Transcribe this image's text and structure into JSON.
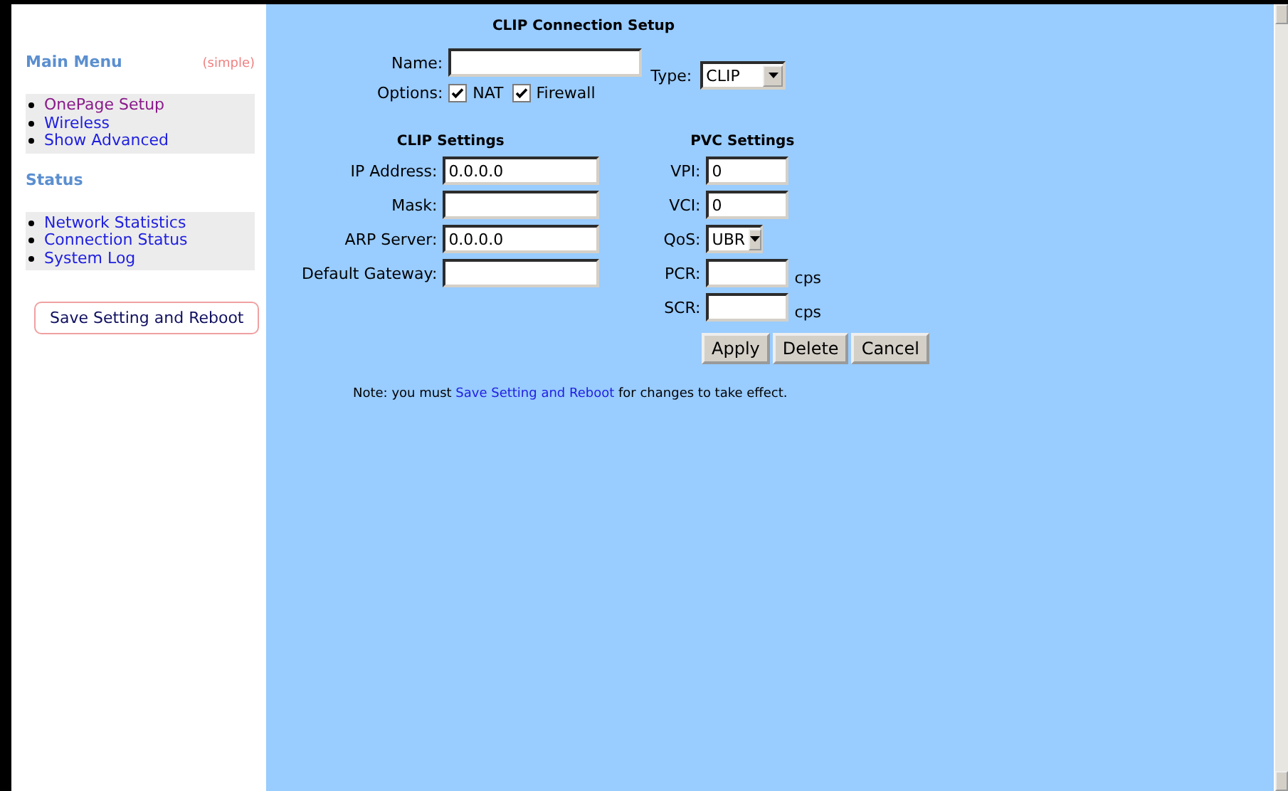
{
  "sidebar": {
    "sections": [
      {
        "title": "Main Menu",
        "badge": "(simple)",
        "links": [
          {
            "label": "OnePage Setup",
            "visited": true
          },
          {
            "label": "Wireless",
            "visited": false
          },
          {
            "label": "Show Advanced",
            "visited": false
          }
        ]
      },
      {
        "title": "Status",
        "links": [
          {
            "label": "Network Statistics",
            "visited": false
          },
          {
            "label": "Connection Status",
            "visited": false
          },
          {
            "label": "System Log",
            "visited": false
          }
        ]
      }
    ],
    "button": "Save Setting and Reboot"
  },
  "main": {
    "title": "CLIP Connection Setup",
    "name": {
      "label": "Name:"
    },
    "options": {
      "label": "Options:",
      "items": [
        {
          "label": "NAT",
          "checked": true
        },
        {
          "label": "Firewall",
          "checked": true
        }
      ]
    },
    "type": {
      "label": "Type:",
      "value": "CLIP"
    },
    "clip_settings": {
      "heading": "CLIP Settings",
      "fields": [
        {
          "label": "IP Address:",
          "value": "0.0.0.0"
        },
        {
          "label": "Mask:"
        },
        {
          "label": "ARP Server:",
          "value": "0.0.0.0"
        },
        {
          "label": "Default Gateway:"
        }
      ]
    },
    "pvc_settings": {
      "heading": "PVC Settings",
      "fields": [
        {
          "kind": "input",
          "label": "VPI:",
          "value": "0"
        },
        {
          "kind": "input",
          "label": "VCI:",
          "value": "0"
        },
        {
          "kind": "select",
          "label": "QoS:",
          "value": "UBR"
        },
        {
          "kind": "input",
          "label": "PCR:",
          "unit": "cps"
        },
        {
          "kind": "input",
          "label": "SCR:",
          "unit": "cps"
        }
      ]
    },
    "buttons": [
      "Apply",
      "Delete",
      "Cancel"
    ],
    "note": {
      "before": "Note: you must",
      "link": "Save Setting and Reboot",
      "after": "for changes to take effect."
    }
  }
}
